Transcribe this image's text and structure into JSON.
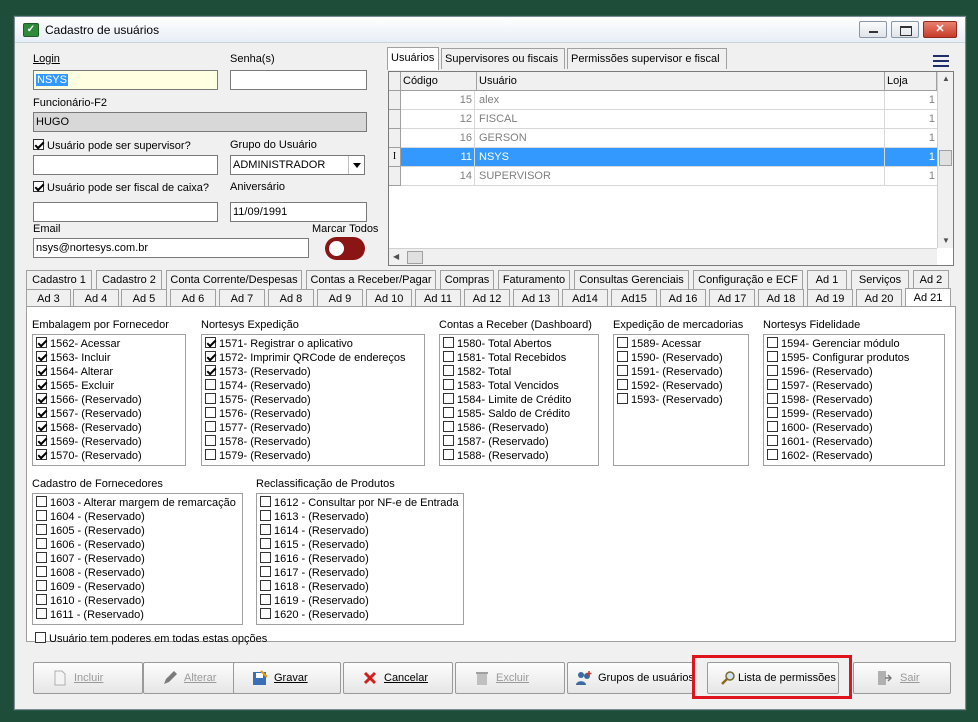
{
  "window": {
    "title": "Cadastro de usuários"
  },
  "form": {
    "login_label": "Login",
    "login_value": "NSYS",
    "senha_label": "Senha(s)",
    "senha_value": "",
    "funcionario_label": "Funcionário-F2",
    "funcionario_value": "HUGO",
    "supervisor_check_label": "Usuário pode ser supervisor?",
    "supervisor_value": "",
    "grupo_label": "Grupo do Usuário",
    "grupo_value": "ADMINISTRADOR",
    "fiscal_check_label": "Usuário pode ser fiscal de caixa?",
    "fiscal_value": "",
    "aniversario_label": "Aniversário",
    "aniversario_value": "11/09/1991",
    "email_label": "Email",
    "email_value": "nsys@nortesys.com.br",
    "marcar_todos_label": "Marcar Todos"
  },
  "right_tabs": [
    "Usuários",
    "Supervisores ou fiscais",
    "Permissões supervisor e fiscal"
  ],
  "grid": {
    "columns": [
      "Código",
      "Usuário",
      "Loja"
    ],
    "rows": [
      {
        "code": "15",
        "user": "alex",
        "loja": "1"
      },
      {
        "code": "12",
        "user": "FISCAL",
        "loja": "1"
      },
      {
        "code": "16",
        "user": "GERSON",
        "loja": "1"
      },
      {
        "code": "11",
        "user": "NSYS",
        "loja": "1",
        "selected": true,
        "indicator": "I"
      },
      {
        "code": "14",
        "user": "SUPERVISOR",
        "loja": "1"
      }
    ]
  },
  "perm_tabs_row1": [
    "Cadastro 1",
    "Cadastro 2",
    "Conta Corrente/Despesas",
    "Contas a Receber/Pagar",
    "Compras",
    "Faturamento",
    "Consultas Gerenciais",
    "Configuração e ECF",
    "Ad 1",
    "Serviços",
    "Ad 2"
  ],
  "perm_tabs_row2": [
    "Ad 3",
    "Ad 4",
    "Ad 5",
    "Ad 6",
    "Ad 7",
    "Ad 8",
    "Ad 9",
    "Ad 10",
    "Ad 11",
    "Ad 12",
    "Ad 13",
    "Ad14",
    "Ad15",
    "Ad 16",
    "Ad 17",
    "Ad 18",
    "Ad 19",
    "Ad 20",
    "Ad 21"
  ],
  "groups": [
    {
      "title": "Embalagem por Fornecedor",
      "items": [
        {
          "t": "1562- Acessar",
          "c": true
        },
        {
          "t": "1563- Incluir",
          "c": true
        },
        {
          "t": "1564- Alterar",
          "c": true
        },
        {
          "t": "1565- Excluir",
          "c": true
        },
        {
          "t": "1566- (Reservado)",
          "c": true
        },
        {
          "t": "1567- (Reservado)",
          "c": true
        },
        {
          "t": "1568- (Reservado)",
          "c": true
        },
        {
          "t": "1569- (Reservado)",
          "c": true
        },
        {
          "t": "1570- (Reservado)",
          "c": true
        }
      ]
    },
    {
      "title": "Nortesys Expedição",
      "items": [
        {
          "t": "1571- Registrar o aplicativo",
          "c": true
        },
        {
          "t": "1572- Imprimir QRCode de endereços",
          "c": true
        },
        {
          "t": "1573- (Reservado)",
          "c": true
        },
        {
          "t": "1574- (Reservado)",
          "c": false
        },
        {
          "t": "1575- (Reservado)",
          "c": false
        },
        {
          "t": "1576- (Reservado)",
          "c": false
        },
        {
          "t": "1577- (Reservado)",
          "c": false
        },
        {
          "t": "1578- (Reservado)",
          "c": false
        },
        {
          "t": "1579- (Reservado)",
          "c": false
        }
      ]
    },
    {
      "title": "Contas a Receber (Dashboard)",
      "items": [
        {
          "t": "1580- Total Abertos",
          "c": false
        },
        {
          "t": "1581- Total Recebidos",
          "c": false
        },
        {
          "t": "1582- Total",
          "c": false
        },
        {
          "t": "1583- Total Vencidos",
          "c": false
        },
        {
          "t": "1584- Limite de Crédito",
          "c": false
        },
        {
          "t": "1585- Saldo de Crédito",
          "c": false
        },
        {
          "t": "1586- (Reservado)",
          "c": false
        },
        {
          "t": "1587- (Reservado)",
          "c": false
        },
        {
          "t": "1588- (Reservado)",
          "c": false
        }
      ]
    },
    {
      "title": "Expedição de mercadorias",
      "items": [
        {
          "t": "1589- Acessar",
          "c": false
        },
        {
          "t": "1590- (Reservado)",
          "c": false
        },
        {
          "t": "1591- (Reservado)",
          "c": false
        },
        {
          "t": "1592- (Reservado)",
          "c": false
        },
        {
          "t": "1593- (Reservado)",
          "c": false
        }
      ]
    },
    {
      "title": "Nortesys Fidelidade",
      "items": [
        {
          "t": "1594- Gerenciar módulo",
          "c": false
        },
        {
          "t": "1595- Configurar produtos",
          "c": false
        },
        {
          "t": "1596- (Reservado)",
          "c": false
        },
        {
          "t": "1597- (Reservado)",
          "c": false
        },
        {
          "t": "1598- (Reservado)",
          "c": false
        },
        {
          "t": "1599- (Reservado)",
          "c": false
        },
        {
          "t": "1600- (Reservado)",
          "c": false
        },
        {
          "t": "1601- (Reservado)",
          "c": false
        },
        {
          "t": "1602- (Reservado)",
          "c": false
        }
      ]
    },
    {
      "title": "Cadastro de Fornecedores",
      "items": [
        {
          "t": "1603 - Alterar margem de remarcação",
          "c": false
        },
        {
          "t": "1604 - (Reservado)",
          "c": false
        },
        {
          "t": "1605 - (Reservado)",
          "c": false
        },
        {
          "t": "1606 - (Reservado)",
          "c": false
        },
        {
          "t": "1607 - (Reservado)",
          "c": false
        },
        {
          "t": "1608 - (Reservado)",
          "c": false
        },
        {
          "t": "1609 - (Reservado)",
          "c": false
        },
        {
          "t": "1610 - (Reservado)",
          "c": false
        },
        {
          "t": "1611 - (Reservado)",
          "c": false
        }
      ]
    },
    {
      "title": "Reclassificação de Produtos",
      "items": [
        {
          "t": "1612 - Consultar por NF-e de Entrada",
          "c": false
        },
        {
          "t": "1613 - (Reservado)",
          "c": false
        },
        {
          "t": "1614 - (Reservado)",
          "c": false
        },
        {
          "t": "1615 - (Reservado)",
          "c": false
        },
        {
          "t": "1616 - (Reservado)",
          "c": false
        },
        {
          "t": "1617 - (Reservado)",
          "c": false
        },
        {
          "t": "1618 - (Reservado)",
          "c": false
        },
        {
          "t": "1619 - (Reservado)",
          "c": false
        },
        {
          "t": "1620 - (Reservado)",
          "c": false
        }
      ]
    }
  ],
  "all_powers_label": "Usuário tem poderes em todas estas opções",
  "toolbar": {
    "incluir": "Incluir",
    "alterar": "Alterar",
    "gravar": "Gravar",
    "cancelar": "Cancelar",
    "excluir": "Excluir",
    "grupos": "Grupos de usuários",
    "lista": "Lista de permissões",
    "sair": "Sair"
  },
  "colors": {
    "selection": "#3399ff",
    "highlight": "#e0141c",
    "toggle": "#8b1414",
    "desktop": "#1e4d3a"
  }
}
